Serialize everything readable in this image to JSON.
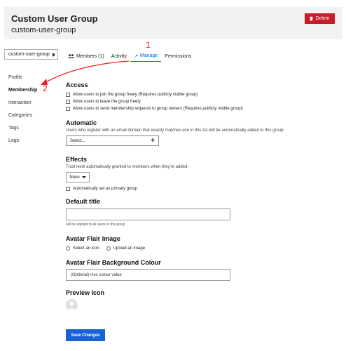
{
  "header": {
    "title": "Custom User Group",
    "slug": "custom-user-group",
    "delete_label": "Delete"
  },
  "group_selector": {
    "label": "custom-user-group"
  },
  "tabs": [
    {
      "label": "Members (1)",
      "icon": "users-icon"
    },
    {
      "label": "Activity"
    },
    {
      "label": "Manage",
      "icon": "wrench-icon",
      "active": true
    },
    {
      "label": "Permissions"
    }
  ],
  "sidebar": {
    "items": [
      "Profile",
      "Membership",
      "Interaction",
      "Categories",
      "Tags",
      "Logs"
    ],
    "active": "Membership"
  },
  "access": {
    "heading": "Access",
    "options": [
      "Allow users to join the group freely (Requires publicly visible group)",
      "Allow users to leave the group freely",
      "Allow users to send membership requests to group owners (Requires publicly visible group)"
    ]
  },
  "automatic": {
    "heading": "Automatic",
    "help": "Users who register with an email domain that exactly matches one in this list will be automatically added to this group:",
    "select_placeholder": "Select..."
  },
  "effects": {
    "heading": "Effects",
    "help": "Trust level automatically granted to members when they're added:",
    "trust_level": "None",
    "primary_label": "Automatically set as primary group"
  },
  "default_title": {
    "heading": "Default title",
    "help": "will be applied to all users in the group"
  },
  "avatar_flair": {
    "heading": "Avatar Flair Image",
    "options": [
      "Select an icon",
      "Upload an image"
    ]
  },
  "flair_bg": {
    "heading": "Avatar Flair Background Colour",
    "placeholder": "(Optional) Hex colour value"
  },
  "preview": {
    "heading": "Preview Icon"
  },
  "save_label": "Save Changes",
  "annotations": [
    "1",
    "2"
  ],
  "colors": {
    "accent": "#1863d8",
    "danger": "#c51d2a",
    "annotation": "#e82222",
    "header_bg": "#f2f2f2"
  }
}
